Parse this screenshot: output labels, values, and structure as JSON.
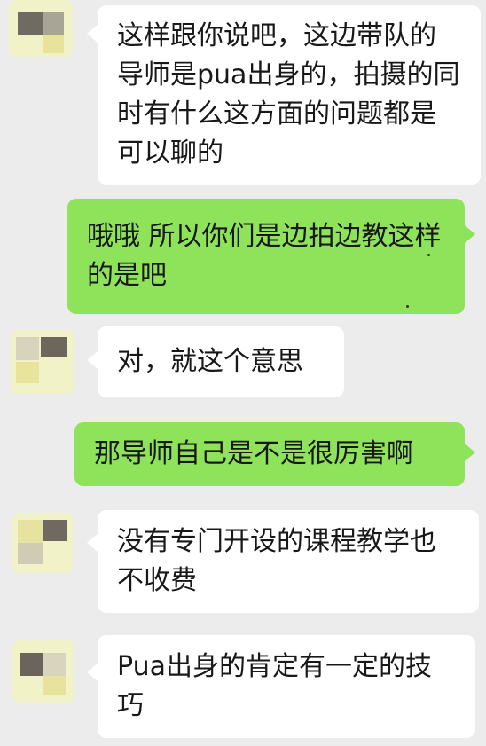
{
  "messages": [
    {
      "sender": "contact",
      "text": "这样跟你说吧，这边带队的导师是pua出身的，拍摄的同时有什么这方面的问题都是可以聊的"
    },
    {
      "sender": "self",
      "text": "哦哦 所以你们是边拍边教这样的是吧"
    },
    {
      "sender": "contact",
      "text": "对，就这个意思"
    },
    {
      "sender": "self",
      "text": "那导师自己是不是很厉害啊"
    },
    {
      "sender": "contact",
      "text": "没有专门开设的课程教学也不收费"
    },
    {
      "sender": "contact",
      "text": "Pua出身的肯定有一定的技巧"
    }
  ],
  "colors": {
    "background": "#ececec",
    "incoming_bubble": "#ffffff",
    "outgoing_bubble": "#8fe35b",
    "avatar_tint": "#f2f2c8"
  },
  "icons": {
    "contact_avatar": "blurred-avatar"
  }
}
